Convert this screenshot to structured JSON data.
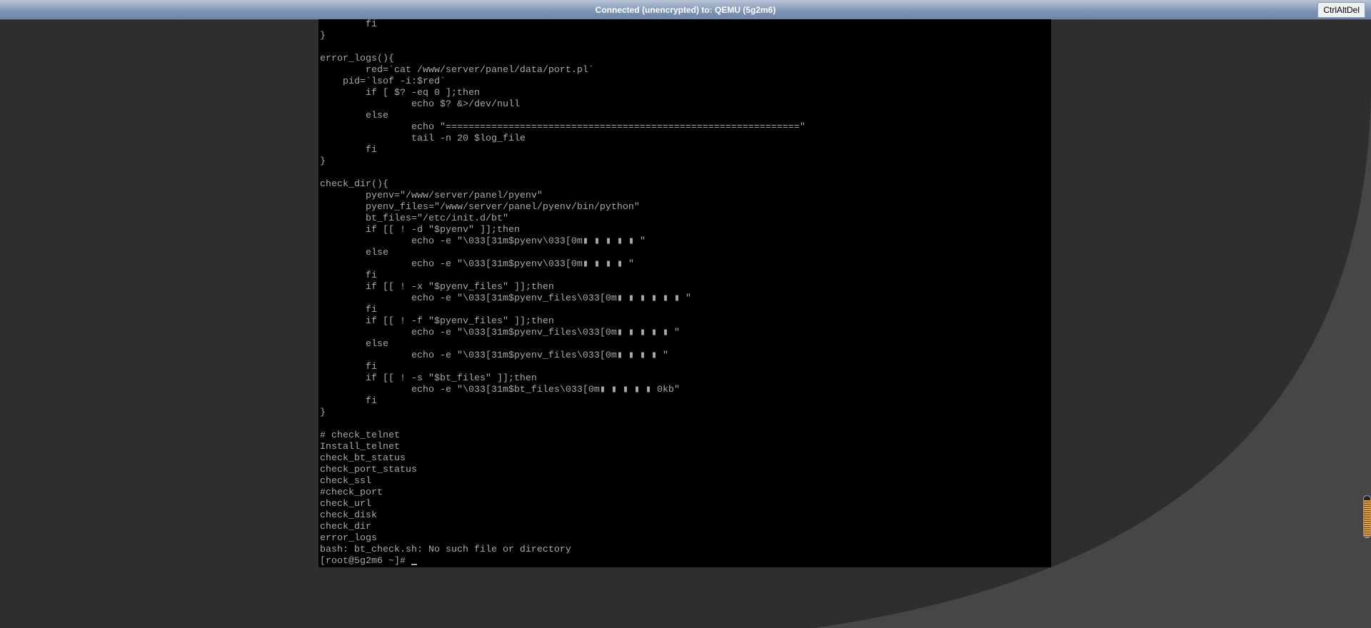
{
  "window": {
    "status": "Connected (unencrypted) to: QEMU (5g2m6)",
    "ctrl_alt_del_label": "CtrlAltDel"
  },
  "terminal": {
    "lines": [
      "        fi",
      "}",
      "",
      "error_logs(){",
      "        red=`cat /www/server/panel/data/port.pl`",
      "    pid=`lsof -i:$red`",
      "        if [ $? -eq 0 ];then",
      "                echo $? &>/dev/null",
      "        else",
      "                echo \"==============================================================\"",
      "                tail -n 20 $log_file",
      "        fi",
      "}",
      "",
      "check_dir(){",
      "        pyenv=\"/www/server/panel/pyenv\"",
      "        pyenv_files=\"/www/server/panel/pyenv/bin/python\"",
      "        bt_files=\"/etc/init.d/bt\"",
      "        if [[ ! -d \"$pyenv\" ]];then",
      "                echo -e \"\\033[31m$pyenv\\033[0m▮ ▮ ▮ ▮ ▮ \"",
      "        else",
      "                echo -e \"\\033[31m$pyenv\\033[0m▮ ▮ ▮ ▮ \"",
      "        fi",
      "        if [[ ! -x \"$pyenv_files\" ]];then",
      "                echo -e \"\\033[31m$pyenv_files\\033[0m▮ ▮ ▮ ▮ ▮ ▮ \"",
      "        fi",
      "        if [[ ! -f \"$pyenv_files\" ]];then",
      "                echo -e \"\\033[31m$pyenv_files\\033[0m▮ ▮ ▮ ▮ ▮ \"",
      "        else",
      "                echo -e \"\\033[31m$pyenv_files\\033[0m▮ ▮ ▮ ▮ \"",
      "        fi",
      "        if [[ ! -s \"$bt_files\" ]];then",
      "                echo -e \"\\033[31m$bt_files\\033[0m▮ ▮ ▮ ▮ ▮ 0kb\"",
      "        fi",
      "}",
      "",
      "# check_telnet",
      "Install_telnet",
      "check_bt_status",
      "check_port_status",
      "check_ssl",
      "#check_port",
      "check_url",
      "check_disk",
      "check_dir",
      "error_logs",
      "bash: bt_check.sh: No such file or directory"
    ],
    "prompt": "[root@5g2m6 ~]# "
  },
  "colors": {
    "terminal_bg": "#000000",
    "terminal_fg": "#aaaaaa"
  }
}
